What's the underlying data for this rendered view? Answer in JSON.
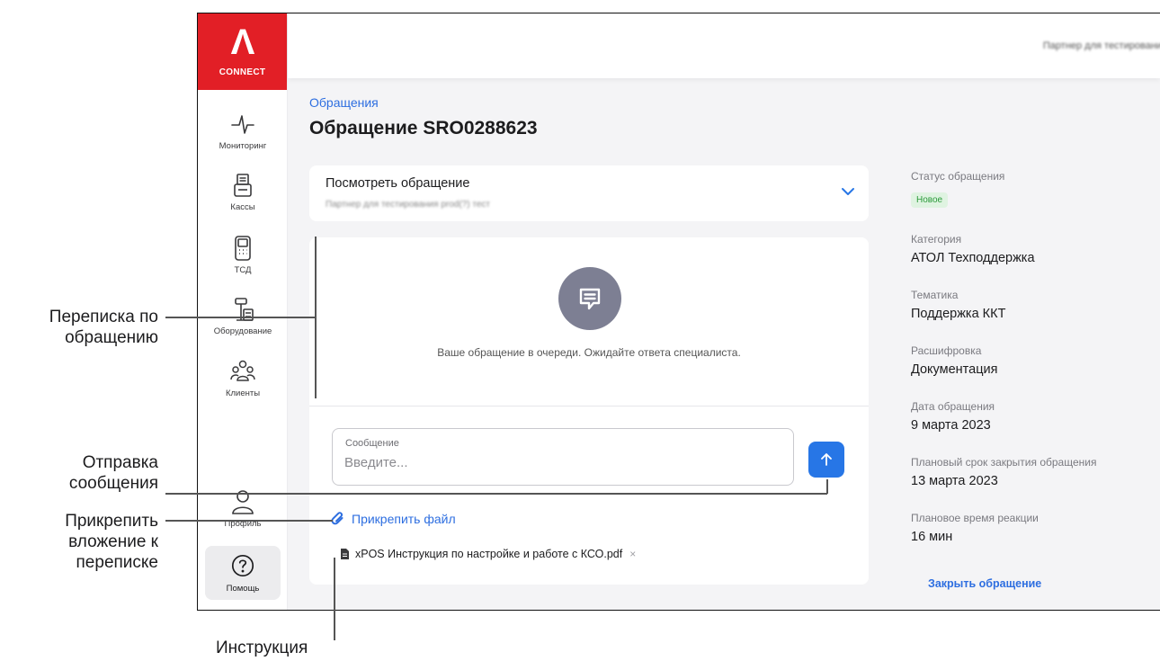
{
  "brand": {
    "logo_mark": "Λ",
    "logo_word": "CONNECT",
    "color": "#e21f26"
  },
  "topbar": {
    "partner_name": "Партнер для тестирования"
  },
  "sidebar": {
    "items": [
      {
        "label": "Мониторинг",
        "icon": "pulse-icon"
      },
      {
        "label": "Кассы",
        "icon": "cash-register-icon"
      },
      {
        "label": "ТСД",
        "icon": "scanner-icon"
      },
      {
        "label": "Оборудование",
        "icon": "scale-icon"
      },
      {
        "label": "Клиенты",
        "icon": "clients-icon"
      },
      {
        "label": "Профиль",
        "icon": "profile-icon"
      },
      {
        "label": "Помощь",
        "icon": "help-icon"
      }
    ]
  },
  "page": {
    "breadcrumb": "Обращения",
    "title": "Обращение SRO0288623"
  },
  "view_card": {
    "label": "Посмотреть обращение",
    "subtitle": "Партнер для тестирования prod(?) тест"
  },
  "chat": {
    "queue_text": "Ваше обращение в очереди. Ожидайте ответа специалиста.",
    "message_label": "Сообщение",
    "message_placeholder": "Введите...",
    "attach_label": "Прикрепить файл",
    "file_name": "xPOS Инструкция по настройке и работе с КСО.pdf",
    "file_remove": "×"
  },
  "info": {
    "status_label": "Статус обращения",
    "status_value": "Новое",
    "category_label": "Категория",
    "category_value": "АТОЛ Техподдержка",
    "topic_label": "Тематика",
    "topic_value": "Поддержка ККТ",
    "decoding_label": "Расшифровка",
    "decoding_value": "Документация",
    "date_label": "Дата обращения",
    "date_value": "9 марта 2023",
    "deadline_label": "Плановый срок закрытия обращения",
    "deadline_value": "13 марта 2023",
    "reaction_label": "Плановое время реакции",
    "reaction_value": "16 мин",
    "close_link": "Закрыть обращение"
  },
  "callouts": {
    "conversation_1": "Переписка по",
    "conversation_2": "обращению",
    "send_1": "Отправка",
    "send_2": "сообщения",
    "attach_1": "Прикрепить",
    "attach_2": "вложение к",
    "attach_3": "переписке",
    "instruction": "Инструкция"
  },
  "colors": {
    "accent": "#2776e6",
    "link": "#2d6ee0",
    "status_bg": "#dff3e1",
    "status_text": "#2b9a3a"
  }
}
